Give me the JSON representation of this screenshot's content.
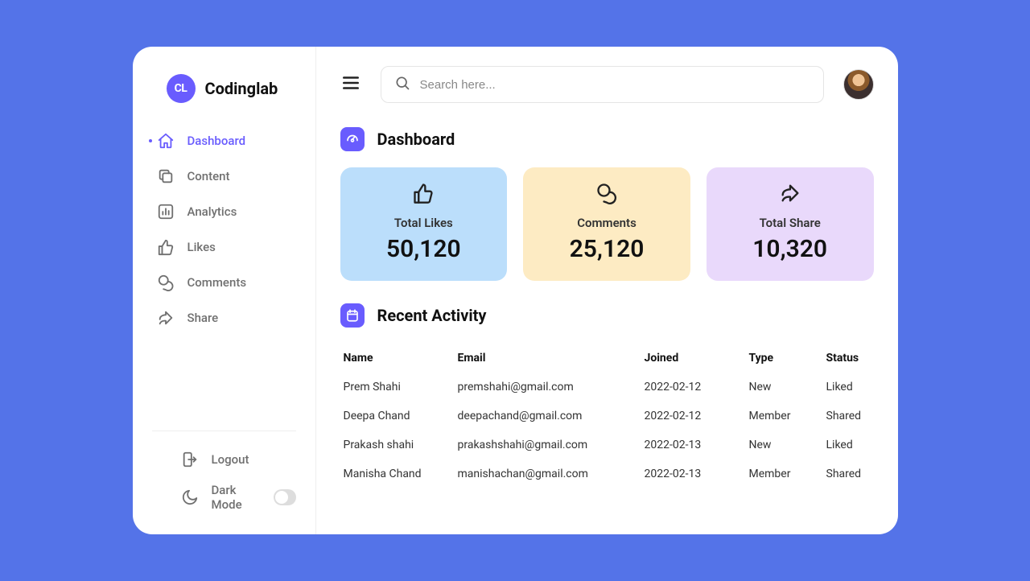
{
  "brand": {
    "logo_text": "CL",
    "name": "Codinglab"
  },
  "sidebar": {
    "items": [
      {
        "label": "Dashboard"
      },
      {
        "label": "Content"
      },
      {
        "label": "Analytics"
      },
      {
        "label": "Likes"
      },
      {
        "label": "Comments"
      },
      {
        "label": "Share"
      }
    ],
    "logout_label": "Logout",
    "darkmode_label": "Dark Mode"
  },
  "search": {
    "placeholder": "Search here..."
  },
  "dashboard": {
    "title": "Dashboard",
    "cards": [
      {
        "label": "Total Likes",
        "value": "50,120"
      },
      {
        "label": "Comments",
        "value": "25,120"
      },
      {
        "label": "Total Share",
        "value": "10,320"
      }
    ]
  },
  "activity": {
    "title": "Recent Activity",
    "headers": {
      "name": "Name",
      "email": "Email",
      "joined": "Joined",
      "type": "Type",
      "status": "Status"
    },
    "rows": [
      {
        "name": "Prem Shahi",
        "email": "premshahi@gmail.com",
        "joined": "2022-02-12",
        "type": "New",
        "status": "Liked"
      },
      {
        "name": "Deepa Chand",
        "email": "deepachand@gmail.com",
        "joined": "2022-02-12",
        "type": "Member",
        "status": "Shared"
      },
      {
        "name": "Prakash shahi",
        "email": "prakashshahi@gmail.com",
        "joined": "2022-02-13",
        "type": "New",
        "status": "Liked"
      },
      {
        "name": "Manisha Chand",
        "email": "manishachan@gmail.com",
        "joined": "2022-02-13",
        "type": "Member",
        "status": "Shared"
      }
    ]
  }
}
